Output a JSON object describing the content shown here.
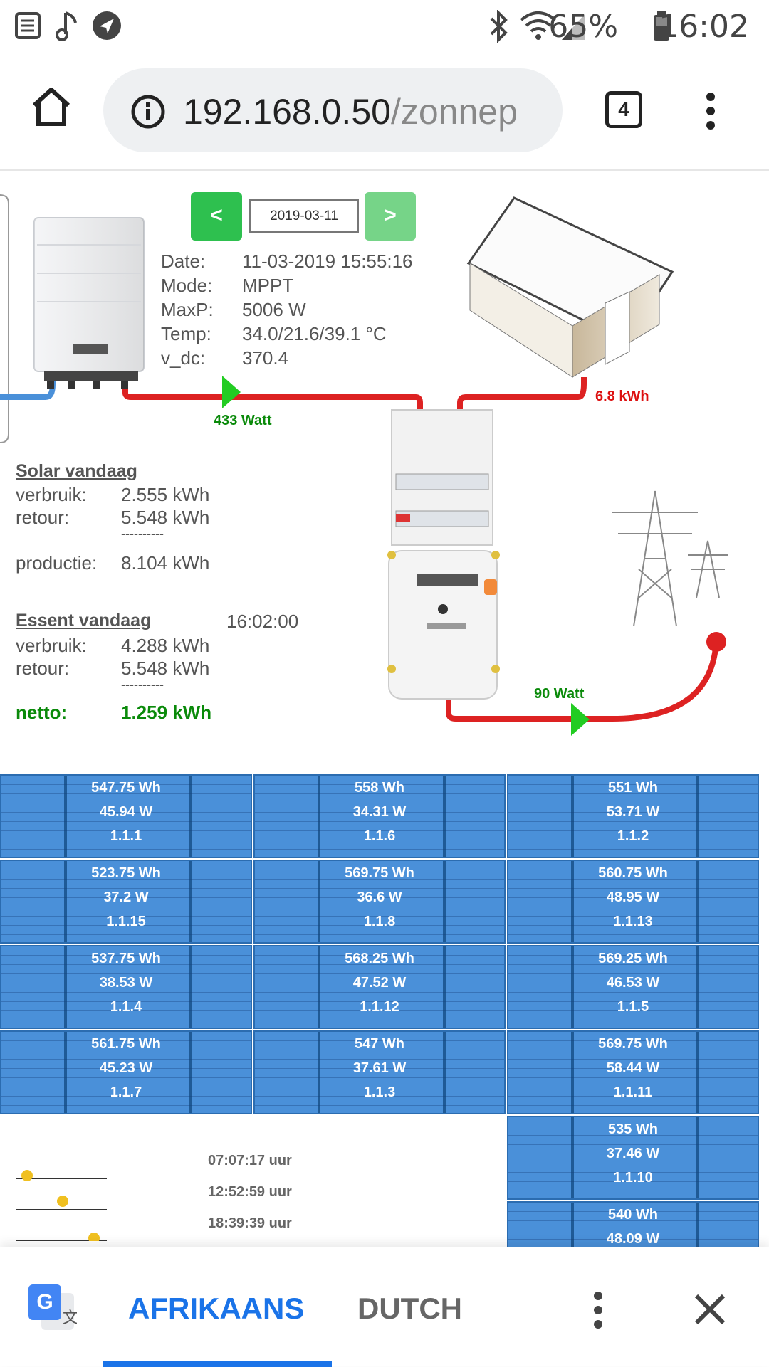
{
  "status_bar": {
    "battery_percent": "65%",
    "time": "16:02"
  },
  "browser": {
    "url_host": "192.168.0.50",
    "url_path": "/zonnep",
    "tab_count": "4"
  },
  "inverter": {
    "prev_label": "<",
    "next_label": ">",
    "date_input": "2019-03-11",
    "rows": [
      {
        "label": "Date:",
        "value": "11-03-2019 15:55:16"
      },
      {
        "label": "Mode:",
        "value": "MPPT"
      },
      {
        "label": "MaxP:",
        "value": "5006 W"
      },
      {
        "label": "Temp:",
        "value": "34.0/21.6/39.1 °C"
      },
      {
        "label": "v_dc:",
        "value": "370.4"
      }
    ],
    "solar_watt": "433 Watt"
  },
  "house": {
    "energy": "6.8 kWh"
  },
  "grid": {
    "watt": "90 Watt"
  },
  "solar_today": {
    "title": "Solar vandaag",
    "rows": [
      {
        "label": "verbruik:",
        "value": "2.555 kWh"
      },
      {
        "label": "retour:",
        "value": "5.548 kWh"
      }
    ],
    "separator": "----------",
    "production_label": "productie:",
    "production_value": "8.104 kWh"
  },
  "essent_today": {
    "title": "Essent vandaag",
    "time": "16:02:00",
    "rows": [
      {
        "label": "verbruik:",
        "value": "4.288 kWh"
      },
      {
        "label": "retour:",
        "value": "5.548 kWh"
      }
    ],
    "separator": "----------",
    "net_label": "netto:",
    "net_value": "1.259 kWh"
  },
  "panels": [
    {
      "wh": "547.75 Wh",
      "w": "45.94 W",
      "id": "1.1.1"
    },
    {
      "wh": "558 Wh",
      "w": "34.31 W",
      "id": "1.1.6"
    },
    {
      "wh": "551 Wh",
      "w": "53.71 W",
      "id": "1.1.2"
    },
    {
      "wh": "523.75 Wh",
      "w": "37.2 W",
      "id": "1.1.15"
    },
    {
      "wh": "569.75 Wh",
      "w": "36.6 W",
      "id": "1.1.8"
    },
    {
      "wh": "560.75 Wh",
      "w": "48.95 W",
      "id": "1.1.13"
    },
    {
      "wh": "537.75 Wh",
      "w": "38.53 W",
      "id": "1.1.4"
    },
    {
      "wh": "568.25 Wh",
      "w": "47.52 W",
      "id": "1.1.12"
    },
    {
      "wh": "569.25 Wh",
      "w": "46.53 W",
      "id": "1.1.5"
    },
    {
      "wh": "561.75 Wh",
      "w": "45.23 W",
      "id": "1.1.7"
    },
    {
      "wh": "547 Wh",
      "w": "37.61 W",
      "id": "1.1.3"
    },
    {
      "wh": "569.75 Wh",
      "w": "58.44 W",
      "id": "1.1.11"
    },
    {
      "wh": "535 Wh",
      "w": "37.46 W",
      "id": "1.1.10"
    },
    {
      "wh": "540 Wh",
      "w": "48.09 W",
      "id": ""
    }
  ],
  "sun_times": [
    "07:07:17 uur",
    "12:52:59 uur",
    "18:39:39 uur"
  ],
  "translate_bar": {
    "lang_source": "AFRIKAANS",
    "lang_target": "DUTCH"
  },
  "colors": {
    "accent_green": "#2ec04f",
    "panel_blue": "#4a90d9",
    "wire_red": "#dd2222",
    "translate_blue": "#1a73e8"
  }
}
